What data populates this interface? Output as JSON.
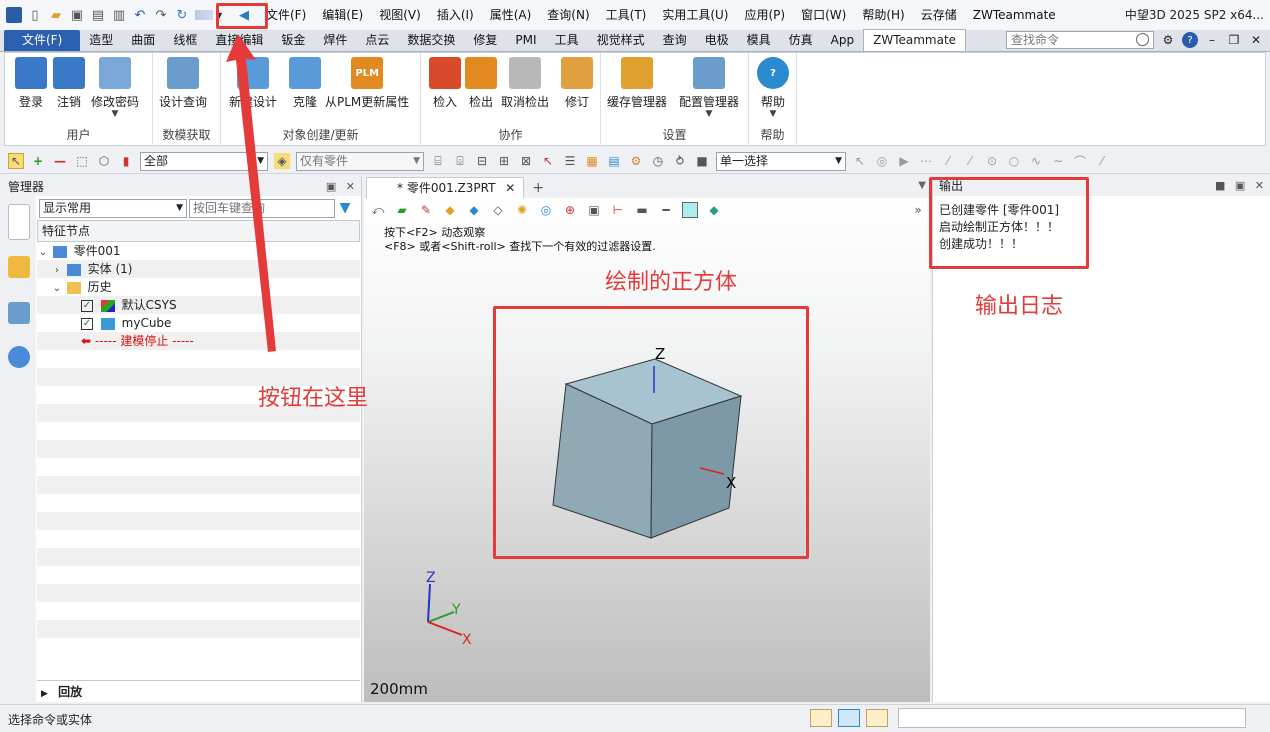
{
  "titlebar": {
    "menu": [
      "文件(F)",
      "编辑(E)",
      "视图(V)",
      "插入(I)",
      "属性(A)",
      "查询(N)",
      "工具(T)",
      "实用工具(U)",
      "应用(P)",
      "窗口(W)",
      "帮助(H)",
      "云存储",
      "ZWTeammate"
    ],
    "app_title": "中望3D 2025 SP2 x64..."
  },
  "ribbon_tabs": [
    "文件(F)",
    "造型",
    "曲面",
    "线框",
    "直接编辑",
    "钣金",
    "焊件",
    "点云",
    "数据交换",
    "修复",
    "PMI",
    "工具",
    "视觉样式",
    "查询",
    "电极",
    "模具",
    "仿真",
    "App",
    "ZWTeammate"
  ],
  "active_tab": "ZWTeammate",
  "search_placeholder": "查找命令",
  "ribbon": {
    "groups": [
      {
        "label": "用户",
        "buttons": [
          "登录",
          "注销",
          "修改密码"
        ]
      },
      {
        "label": "数模获取",
        "buttons": [
          "设计查询"
        ]
      },
      {
        "label": "对象创建/更新",
        "buttons": [
          "新建设计",
          "克隆",
          "从PLM更新属性"
        ]
      },
      {
        "label": "协作",
        "buttons": [
          "检入",
          "检出",
          "取消检出",
          "修订"
        ]
      },
      {
        "label": "设置",
        "buttons": [
          "缓存管理器",
          "配置管理器"
        ]
      },
      {
        "label": "帮助",
        "buttons": [
          "帮助"
        ]
      }
    ],
    "badge_plm": "PLM"
  },
  "toolbar2": {
    "filter_all": "全部",
    "filter_part": "仅有零件",
    "select_mode": "单一选择"
  },
  "manager": {
    "title": "管理器",
    "display_combo": "显示常用",
    "search_placeholder": "按回车键查询",
    "column": "特征节点",
    "tree": {
      "root": "零件001",
      "solid": "实体 (1)",
      "history": "历史",
      "csys": "默认CSYS",
      "cube": "myCube",
      "stop": "----- 建模停止 -----"
    },
    "replay": "回放"
  },
  "document": {
    "tab_label": "* 零件001.Z3PRT",
    "hint1": "按下<F2> 动态观察",
    "hint2": "<F8> 或者<Shift-roll> 查找下一个有效的过滤器设置.",
    "scale": "200mm",
    "axis_z": "Z",
    "axis_x": "X",
    "axis_y": "Y"
  },
  "output": {
    "title": "输出",
    "lines": [
      "已创建零件 [零件001]",
      "启动绘制正方体！！！",
      "创建成功！！！"
    ]
  },
  "annotations": {
    "button_note": "按钮在这里",
    "cube_note": "绘制的正方体",
    "log_note": "输出日志",
    "accent": "#e53a3a"
  },
  "status": {
    "text": "选择命令或实体"
  }
}
